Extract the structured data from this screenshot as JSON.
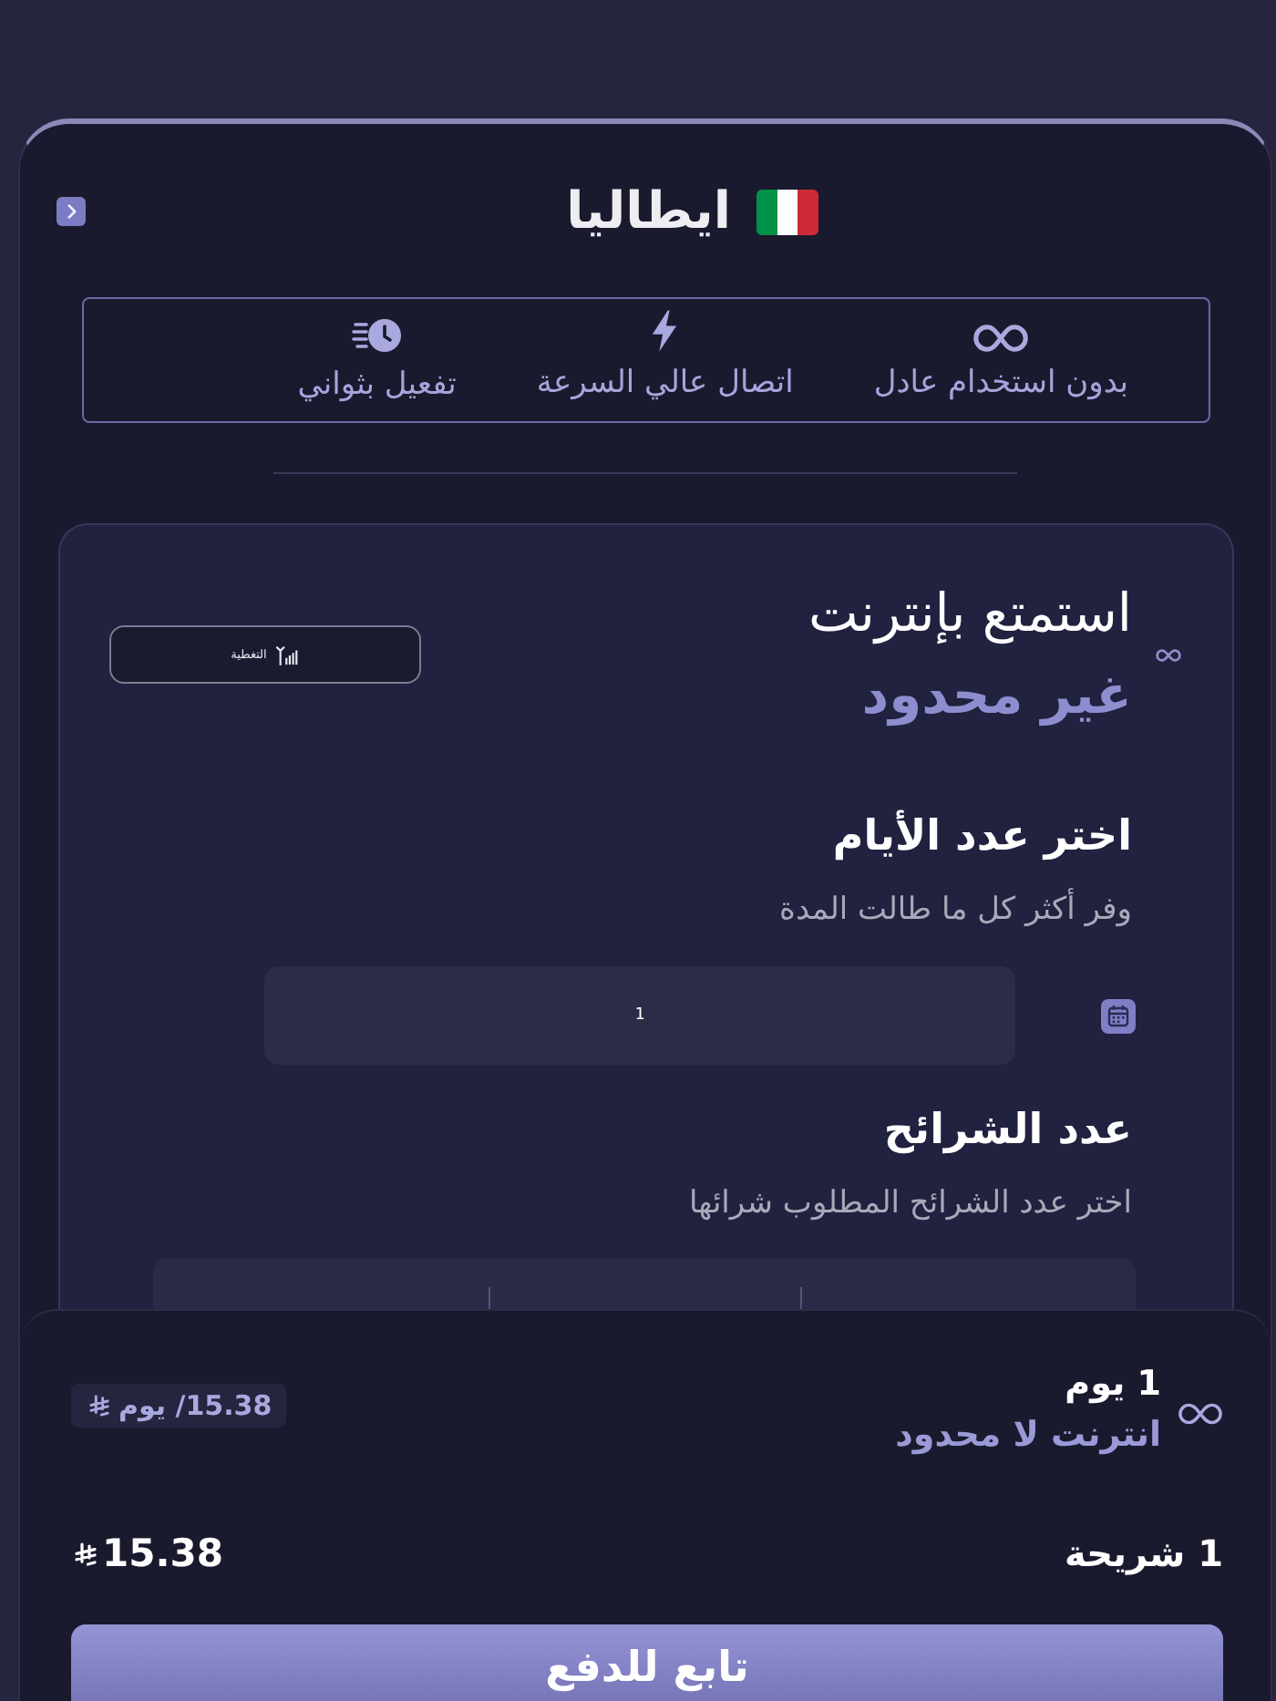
{
  "header": {
    "title": "ايطاليا"
  },
  "features": [
    {
      "kind": "infinity",
      "label": "بدون استخدام عادل"
    },
    {
      "kind": "bolt",
      "label": "اتصال عالي السرعة"
    },
    {
      "kind": "clock",
      "label": "تفعيل بثواني"
    }
  ],
  "hero": {
    "line_1": "استمتع بإنترنت",
    "line_2": "غير محدود",
    "coverage_button": "التغطية"
  },
  "days": {
    "title": "اختر عدد الأيام",
    "subtitle": "وفر أكثر كل ما طالت المدة",
    "value": "1"
  },
  "sims": {
    "title": "عدد الشرائح",
    "subtitle": "اختر عدد الشرائح المطلوب شرائها"
  },
  "summary": {
    "duration": "1 يوم",
    "plan": "انترنت لا محدود",
    "price_per_day": "15.38/ يوم",
    "sims": "1 شريحة",
    "total": "15.38",
    "button": "تابع للدفع"
  }
}
